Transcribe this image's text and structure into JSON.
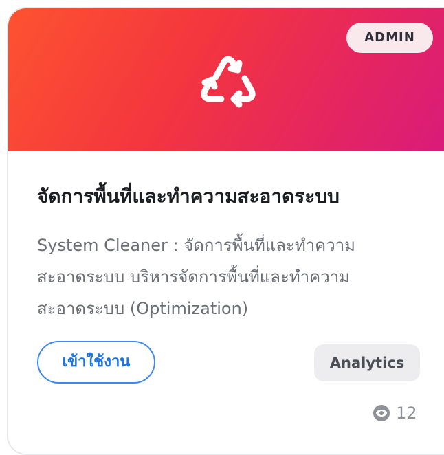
{
  "card": {
    "badge": "ADMIN",
    "icon": "recycle-icon",
    "title": "จัดการพื้นที่และทำความสะอาดระบบ",
    "description_lines": [
      "System Cleaner : จัดการพื้นที่และทำความ",
      "สะอาดระบบ บริหารจัดการพื้นที่และทำความ",
      "สะอาดระบบ (Optimization)"
    ],
    "enter_label": "เข้าใช้งาน",
    "category": "Analytics",
    "view_icon": "eye-icon",
    "views": "12"
  },
  "colors": {
    "gradient_start": "#fd5330",
    "gradient_end": "#d91b7a",
    "accent_blue": "#1b73ea",
    "badge_bg": "#f9e9ec",
    "tag_bg": "#ededf0"
  }
}
